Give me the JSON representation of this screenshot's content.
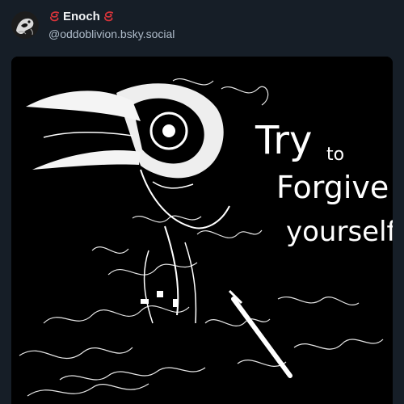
{
  "post": {
    "author": {
      "name_prefix_emoji": "curl-emoji",
      "display_name": "Enoch",
      "name_suffix_emoji": "curl-emoji",
      "handle": "@oddoblivion.bsky.social"
    },
    "media": {
      "art_text": {
        "line1": "Try",
        "line2": "to",
        "line3": "Forgive",
        "line4": "yourself"
      }
    }
  },
  "colors": {
    "background": "#161e27",
    "name_text": "#f1f3f5",
    "handle_text": "#aebbc9",
    "emoji_red": "#d9343a",
    "art_background": "#000000",
    "art_ink": "#ffffff"
  }
}
